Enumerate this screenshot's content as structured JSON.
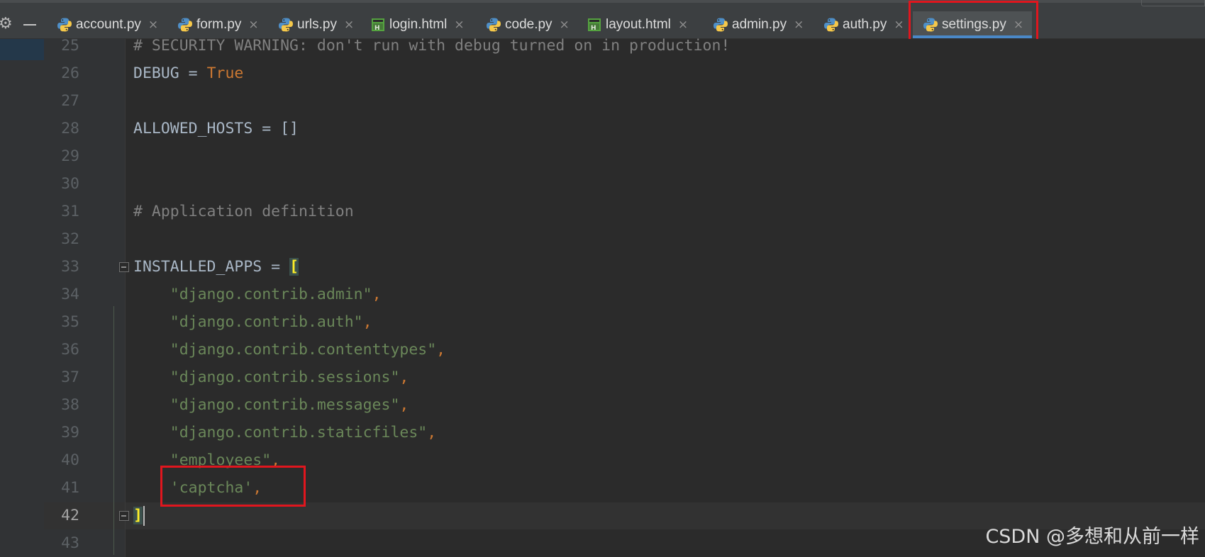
{
  "tabs": [
    {
      "label": "account.py",
      "type": "python"
    },
    {
      "label": "form.py",
      "type": "python"
    },
    {
      "label": "urls.py",
      "type": "python"
    },
    {
      "label": "login.html",
      "type": "html"
    },
    {
      "label": "code.py",
      "type": "python"
    },
    {
      "label": "layout.html",
      "type": "html"
    },
    {
      "label": "admin.py",
      "type": "python"
    },
    {
      "label": "auth.py",
      "type": "python"
    },
    {
      "label": "settings.py",
      "type": "python",
      "active": true
    }
  ],
  "tab_close_glyph": "×",
  "code_lines": [
    {
      "n": "25",
      "tokens": [
        {
          "t": "# SECURITY WARNING: don't run with debug turned on in production!",
          "c": "comment"
        }
      ]
    },
    {
      "n": "26",
      "tokens": [
        {
          "t": "DEBUG = ",
          "c": "name"
        },
        {
          "t": "True",
          "c": "kw"
        }
      ]
    },
    {
      "n": "27",
      "tokens": []
    },
    {
      "n": "28",
      "tokens": [
        {
          "t": "ALLOWED_HOSTS = []",
          "c": "name"
        }
      ]
    },
    {
      "n": "29",
      "tokens": []
    },
    {
      "n": "30",
      "tokens": []
    },
    {
      "n": "31",
      "tokens": [
        {
          "t": "# Application definition",
          "c": "comment"
        }
      ]
    },
    {
      "n": "32",
      "tokens": []
    },
    {
      "n": "33",
      "fold": true,
      "tokens": [
        {
          "t": "INSTALLED_APPS = ",
          "c": "name"
        },
        {
          "t": "[",
          "c": "bracket"
        }
      ]
    },
    {
      "n": "34",
      "tokens": [
        {
          "t": "    ",
          "c": "name"
        },
        {
          "t": "\"django.contrib.admin\"",
          "c": "str"
        },
        {
          "t": ",",
          "c": "punct"
        }
      ]
    },
    {
      "n": "35",
      "tokens": [
        {
          "t": "    ",
          "c": "name"
        },
        {
          "t": "\"django.contrib.auth\"",
          "c": "str"
        },
        {
          "t": ",",
          "c": "punct"
        }
      ]
    },
    {
      "n": "36",
      "tokens": [
        {
          "t": "    ",
          "c": "name"
        },
        {
          "t": "\"django.contrib.contenttypes\"",
          "c": "str"
        },
        {
          "t": ",",
          "c": "punct"
        }
      ]
    },
    {
      "n": "37",
      "tokens": [
        {
          "t": "    ",
          "c": "name"
        },
        {
          "t": "\"django.contrib.sessions\"",
          "c": "str"
        },
        {
          "t": ",",
          "c": "punct"
        }
      ]
    },
    {
      "n": "38",
      "tokens": [
        {
          "t": "    ",
          "c": "name"
        },
        {
          "t": "\"django.contrib.messages\"",
          "c": "str"
        },
        {
          "t": ",",
          "c": "punct"
        }
      ]
    },
    {
      "n": "39",
      "tokens": [
        {
          "t": "    ",
          "c": "name"
        },
        {
          "t": "\"django.contrib.staticfiles\"",
          "c": "str"
        },
        {
          "t": ",",
          "c": "punct"
        }
      ]
    },
    {
      "n": "40",
      "tokens": [
        {
          "t": "    ",
          "c": "name"
        },
        {
          "t": "\"employees\"",
          "c": "str"
        },
        {
          "t": ",",
          "c": "punct"
        }
      ]
    },
    {
      "n": "41",
      "tokens": [
        {
          "t": "    ",
          "c": "name"
        },
        {
          "t": "'captcha'",
          "c": "str"
        },
        {
          "t": ",",
          "c": "punct"
        }
      ]
    },
    {
      "n": "42",
      "fold": true,
      "current": true,
      "caret": true,
      "tokens": [
        {
          "t": "]",
          "c": "bracket"
        }
      ]
    },
    {
      "n": "43",
      "tokens": []
    }
  ],
  "watermark": "CSDN @多想和从前一样",
  "colors": {
    "background": "#2b2b2b",
    "gutter": "#313335",
    "comment": "#808080",
    "keyword": "#cc7832",
    "string": "#6a8759",
    "identifier": "#a9b7c6",
    "active_tab_underline": "#4a88c7",
    "highlight_box": "#e0161e"
  }
}
